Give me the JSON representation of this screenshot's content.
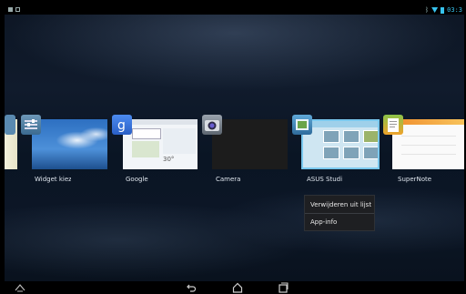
{
  "status_bar": {
    "time": "03:3",
    "left_icons": [
      "notification-icon",
      "screenshot-icon"
    ],
    "right_icons": [
      "bluetooth-icon",
      "wifi-icon",
      "battery-icon"
    ],
    "accent_color": "#37c3ee"
  },
  "recent_apps": [
    {
      "label": "",
      "icon": "widget-app-icon"
    },
    {
      "label": "Widget kiez",
      "icon": "widget-settings-icon"
    },
    {
      "label": "Google",
      "icon": "google-icon"
    },
    {
      "label": "Camera",
      "icon": "camera-icon"
    },
    {
      "label": "ASUS Studi",
      "icon": "asus-studio-icon"
    },
    {
      "label": "SuperNote l",
      "icon": "supernote-icon"
    }
  ],
  "google_thumb": {
    "temperature": "30°"
  },
  "context_menu": {
    "items": [
      "Verwijderen uit lijst",
      "App-info"
    ]
  },
  "nav_bar": {
    "buttons": [
      "asus-menu-icon",
      "back-icon",
      "home-icon",
      "recent-apps-icon"
    ]
  }
}
